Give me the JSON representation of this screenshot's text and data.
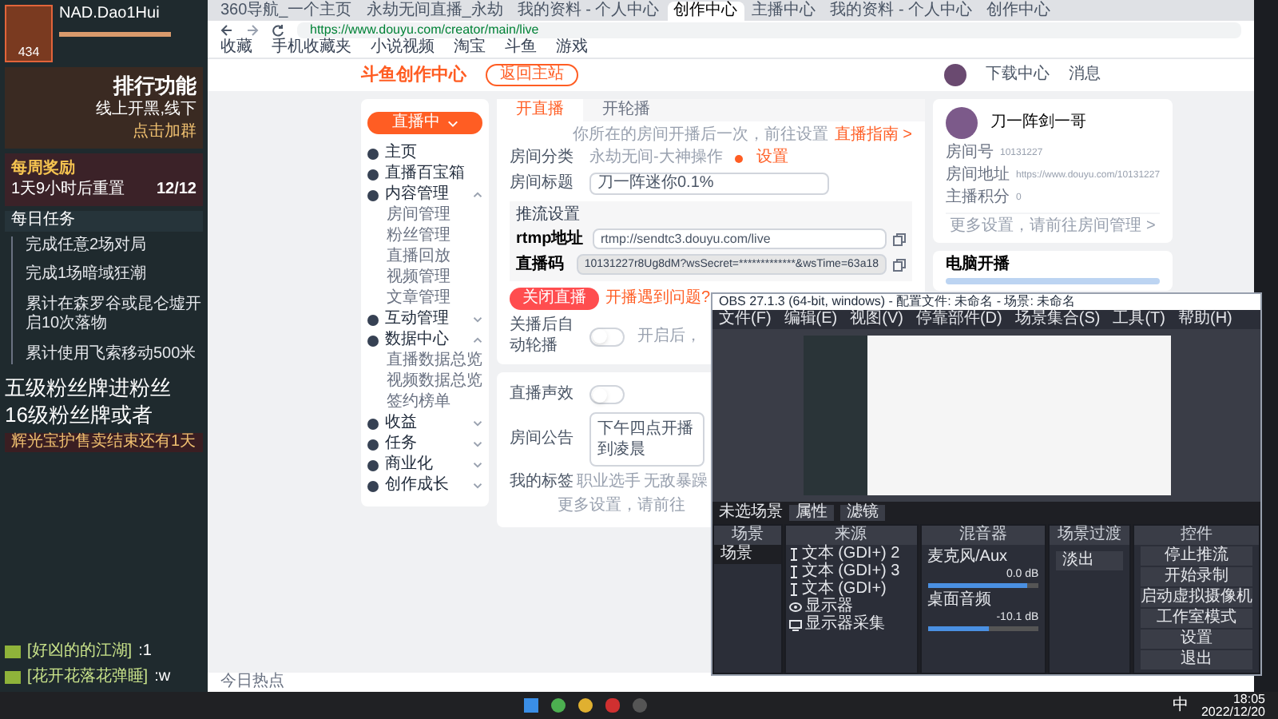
{
  "game_panel": {
    "player_name": "NAD.Dao1Hui",
    "player_level": "434",
    "banner_title": "排行功能",
    "banner_subtitle": "线上开黑,线下",
    "banner_button": "点击加群",
    "weekly": {
      "title": "每周奖励",
      "reset": "1天9小时后重置",
      "count": "12/12"
    },
    "daily_title": "每日任务",
    "tasks": [
      "完成任意2场对局",
      "完成1场暗域狂潮",
      "累计在森罗谷或昆仑墟开启10次落物",
      "累计使用飞索移动500米"
    ],
    "overlay_lines": [
      "五级粉丝牌进粉丝",
      "16级粉丝牌或者"
    ],
    "promo": "辉光宝护售卖结束还有1天",
    "chat": [
      {
        "user": "[好凶的的江湖]",
        "message": ":1"
      },
      {
        "user": "[花开花落花弹睡]",
        "message": ":w"
      }
    ]
  },
  "browser": {
    "tabs": [
      {
        "label": "360导航_一个主页",
        "selected": false
      },
      {
        "label": "永劫无间直播_永劫",
        "selected": false
      },
      {
        "label": "我的资料 - 个人中心",
        "selected": false
      },
      {
        "label": "创作中心",
        "selected": true
      },
      {
        "label": "主播中心",
        "selected": false
      },
      {
        "label": "我的资料 - 个人中心",
        "selected": false
      },
      {
        "label": "创作中心",
        "selected": false
      }
    ],
    "url": "https://www.douyu.com/creator/main/live",
    "bookmarks": [
      "收藏",
      "手机收藏夹",
      "小说视频",
      "淘宝",
      "斗鱼",
      "游戏"
    ],
    "logo": "斗鱼创作中心",
    "back_button": "返回主站",
    "header_actions": [
      "下载中心",
      "消息"
    ],
    "status": "今日热点"
  },
  "sidebar": {
    "live_button": "直播中",
    "items": [
      {
        "label": "主页",
        "kind": "item"
      },
      {
        "label": "直播百宝箱",
        "kind": "item"
      },
      {
        "label": "内容管理",
        "kind": "group",
        "expanded": true,
        "children": [
          {
            "label": "房间管理"
          },
          {
            "label": "粉丝管理"
          },
          {
            "label": "直播回放"
          },
          {
            "label": "视频管理"
          },
          {
            "label": "文章管理"
          }
        ]
      },
      {
        "label": "互动管理",
        "kind": "group",
        "expanded": false
      },
      {
        "label": "数据中心",
        "kind": "group",
        "expanded": true,
        "children": [
          {
            "label": "直播数据总览"
          },
          {
            "label": "视频数据总览"
          },
          {
            "label": "签约榜单"
          }
        ]
      },
      {
        "label": "收益",
        "kind": "group",
        "expanded": false
      },
      {
        "label": "任务",
        "kind": "group",
        "expanded": false
      },
      {
        "label": "商业化",
        "kind": "group",
        "expanded": false
      },
      {
        "label": "创作成长",
        "kind": "group",
        "expanded": false
      }
    ]
  },
  "live_form": {
    "tabs": [
      {
        "label": "开直播",
        "selected": true
      },
      {
        "label": "开轮播",
        "selected": false
      }
    ],
    "notice": "你所在的房间开播后一次，前往设置",
    "notice_link": "直播指南 >",
    "category_label": "房间分类",
    "category_value": "永劫无间-大神操作",
    "category_action": "设置",
    "title_label": "房间标题",
    "title_value": "刀一阵迷你0.1%",
    "stream_heading": "推流设置",
    "rtmp_label": "rtmp地址",
    "rtmp_value": "rtmp://sendtc3.douyu.com/live",
    "code_label": "直播码",
    "code_value": "10131227r8Ug8dM?wsSecret=*************&wsTime=63a18",
    "stop_button": "关闭直播",
    "help_link": "开播遇到问题?",
    "toggles": [
      {
        "label": "关播后自动轮播",
        "on": false,
        "hint": "开启后，"
      },
      {
        "label": "直播声效",
        "on": false
      }
    ],
    "announcement_label": "房间公告",
    "announcement_value": "下午四点开播到凌晨",
    "tags_label": "我的标签",
    "tags": [
      "职业选手",
      "无敌暴躁"
    ],
    "more": "更多设置，请前往"
  },
  "profile": {
    "name": "刀一阵剑一哥",
    "rows": [
      {
        "label": "房间号",
        "value": "10131227"
      },
      {
        "label": "房间地址",
        "value": "https://www.douyu.com/10131227"
      },
      {
        "label": "主播积分",
        "value": "0"
      }
    ],
    "more": "更多设置，请前往房间管理 >",
    "pc_title": "电脑开播"
  },
  "obs": {
    "title": "OBS 27.1.3 (64-bit, windows) - 配置文件: 未命名 - 场景: 未命名",
    "menu": [
      "文件(F)",
      "编辑(E)",
      "视图(V)",
      "停靠部件(D)",
      "场景集合(S)",
      "工具(T)",
      "帮助(H)"
    ],
    "scene_label": "未选场景",
    "scene_buttons": [
      "属性",
      "滤镜"
    ],
    "scenes_title": "场景",
    "scenes": [
      {
        "label": "场景",
        "selected": true
      }
    ],
    "sources_title": "来源",
    "sources": [
      {
        "label": "文本 (GDI+) 2",
        "kind": "text",
        "visible": true
      },
      {
        "label": "文本 (GDI+) 3",
        "kind": "text",
        "visible": true
      },
      {
        "label": "文本 (GDI+)",
        "kind": "text",
        "visible": true
      },
      {
        "label": "显示器",
        "kind": "camera",
        "visible": true
      },
      {
        "label": "显示器采集",
        "kind": "monitor",
        "visible": true
      }
    ],
    "mixer_title": "混音器",
    "mixer": [
      {
        "label": "麦克风/Aux",
        "reading": "0.0 dB",
        "level": 0.9
      },
      {
        "label": "桌面音频",
        "reading": "-10.1 dB",
        "level": 0.55
      }
    ],
    "transition_title": "场景过渡",
    "transition": "淡出",
    "controls_title": "控件",
    "controls": [
      "停止推流",
      "开始录制",
      "启动虚拟摄像机",
      "工作室模式",
      "设置",
      "退出"
    ]
  },
  "taskbar": {
    "time": "18:05",
    "date": "2022/12/20",
    "ime": "中"
  }
}
